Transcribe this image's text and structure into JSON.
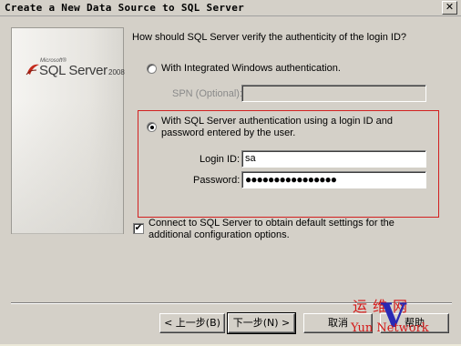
{
  "window": {
    "title": "Create a New Data Source to SQL Server",
    "close_glyph": "✕"
  },
  "logo": {
    "brand": "Microsoft®",
    "name": "SQL Server",
    "year": "2008"
  },
  "question": "How should SQL Server verify the authenticity of the login ID?",
  "auth": {
    "windows_label": "With Integrated Windows authentication.",
    "spn_label": "SPN (Optional):",
    "spn_value": "",
    "sql_label": "With SQL Server authentication using a login ID and password entered by the user.",
    "selected": "sql",
    "login_label": "Login ID:",
    "login_value": "sa",
    "password_label": "Password:",
    "password_value": "●●●●●●●●●●●●●●●●"
  },
  "connect": {
    "checked": true,
    "check_glyph": "✔",
    "label": "Connect to SQL Server to obtain default settings for the additional configuration options."
  },
  "buttons": {
    "back": "< 上一步(B)",
    "next": "下一步(N) >",
    "cancel": "取消",
    "help": "帮助"
  },
  "watermark": {
    "line1": "运维网",
    "line2": "Yun Network",
    "letter": "V"
  },
  "colors": {
    "dialog": "#d4d0c8",
    "highlight_border": "#d22020",
    "watermark": "#d41818"
  }
}
